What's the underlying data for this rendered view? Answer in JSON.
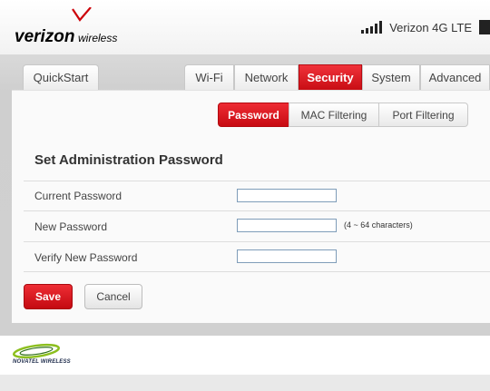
{
  "brand": {
    "wordmark_main": "verizon",
    "wordmark_suffix": "wireless",
    "accent": "#cd040b"
  },
  "status": {
    "carrier": "Verizon 4G LTE",
    "signal_icon": "signal-bars-icon",
    "battery_icon": "battery-icon"
  },
  "nav": {
    "quickstart": "QuickStart",
    "tabs": [
      {
        "label": "Wi-Fi"
      },
      {
        "label": "Network"
      },
      {
        "label": "Security",
        "active": true
      },
      {
        "label": "System"
      },
      {
        "label": "Advanced"
      }
    ]
  },
  "subnav": {
    "tabs": [
      {
        "label": "Password",
        "active": true
      },
      {
        "label": "MAC Filtering"
      },
      {
        "label": "Port Filtering"
      }
    ]
  },
  "form": {
    "title": "Set Administration Password",
    "fields": [
      {
        "label": "Current Password",
        "value": ""
      },
      {
        "label": "New Password",
        "value": "",
        "hint": "(4 ~ 64 characters)"
      },
      {
        "label": "Verify New Password",
        "value": ""
      }
    ],
    "save": "Save",
    "cancel": "Cancel"
  },
  "footer": {
    "vendor": "NOVATEL WIRELESS"
  }
}
